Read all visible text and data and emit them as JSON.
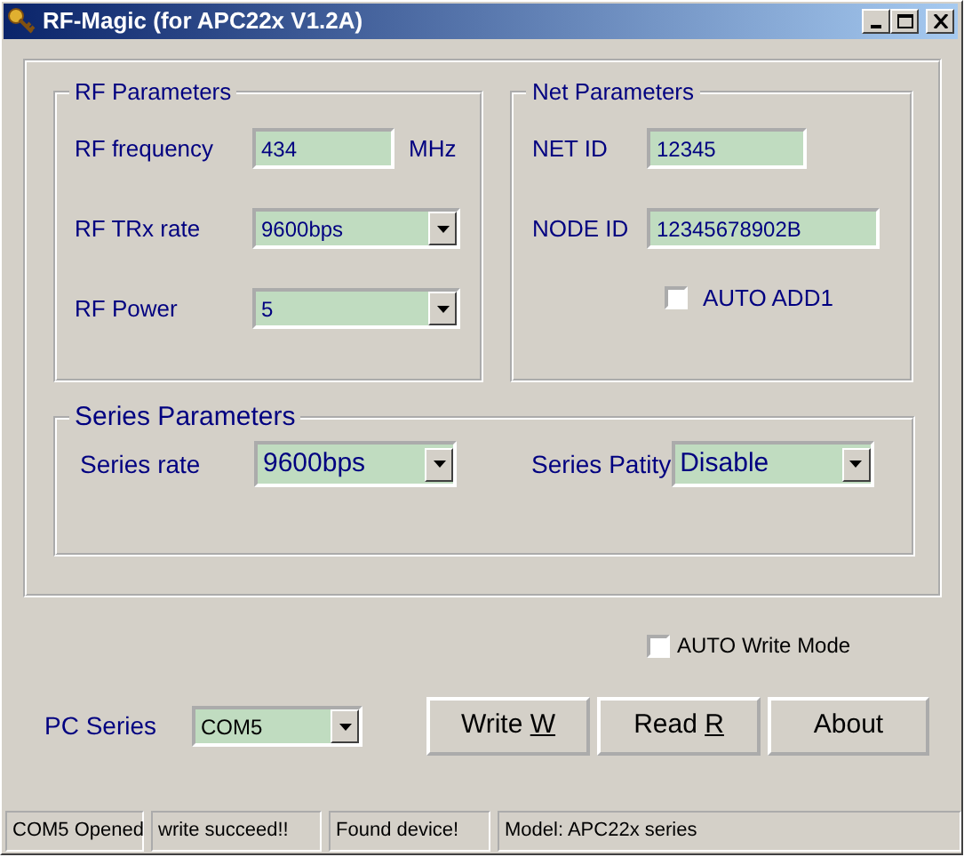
{
  "window": {
    "title": "RF-Magic (for APC22x V1.2A)"
  },
  "rf_parameters": {
    "title": "RF Parameters",
    "fields": [
      {
        "kind": "text",
        "label": "RF frequency",
        "value": "434",
        "unit": "MHz"
      },
      {
        "kind": "select",
        "label": "RF TRx rate",
        "value": "9600bps"
      },
      {
        "kind": "select",
        "label": "RF Power",
        "value": "5"
      }
    ]
  },
  "net_parameters": {
    "title": "Net Parameters",
    "fields": [
      {
        "kind": "text",
        "label": "NET ID",
        "value": "12345"
      },
      {
        "kind": "text",
        "label": "NODE ID",
        "value": "12345678902B"
      }
    ],
    "checkbox": {
      "label": "AUTO ADD1",
      "checked": false
    }
  },
  "series_parameters": {
    "title": "Series Parameters",
    "fields": [
      {
        "label": "Series rate",
        "value": "9600bps"
      },
      {
        "label": "Series Patity",
        "value": "Disable"
      }
    ]
  },
  "auto_write": {
    "label": "AUTO Write Mode",
    "checked": false
  },
  "pc_series": {
    "label": "PC Series",
    "value": "COM5"
  },
  "buttons": [
    {
      "label": "Write",
      "hotkey": "W"
    },
    {
      "label": "Read",
      "hotkey": "R"
    },
    {
      "label": "About"
    }
  ],
  "status_bar": [
    "COM5 Opened",
    "write succeed!!",
    "Found device!",
    "Model: APC22x series"
  ]
}
